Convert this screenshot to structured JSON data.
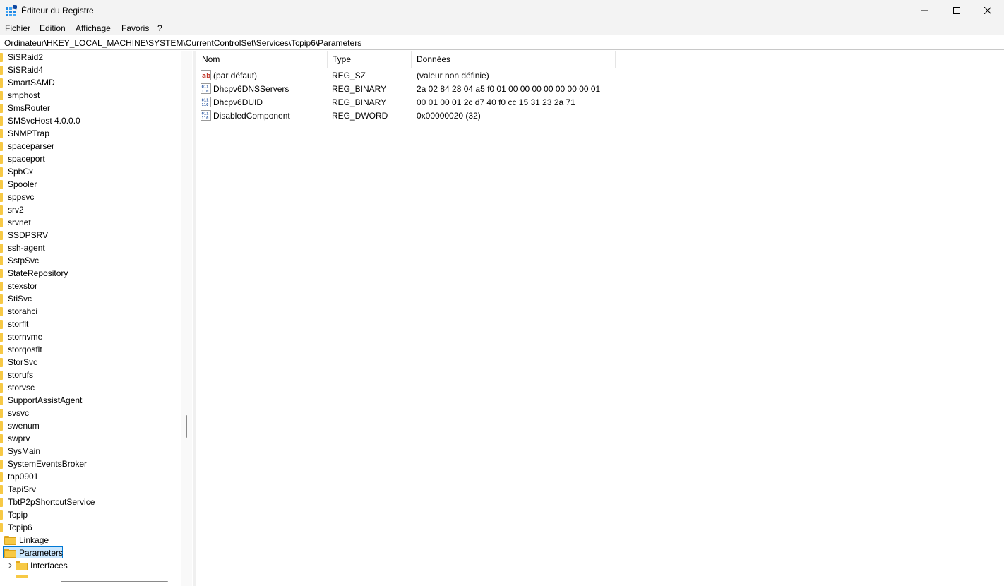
{
  "window": {
    "title": "Éditeur du Registre"
  },
  "menu": [
    "Fichier",
    "Edition",
    "Affichage",
    "Favoris",
    "?"
  ],
  "address": "Ordinateur\\HKEY_LOCAL_MACHINE\\SYSTEM\\CurrentControlSet\\Services\\Tcpip6\\Parameters",
  "tree": {
    "keys": [
      "SiSRaid2",
      "SiSRaid4",
      "SmartSAMD",
      "smphost",
      "SmsRouter",
      "SMSvcHost 4.0.0.0",
      "SNMPTrap",
      "spaceparser",
      "spaceport",
      "SpbCx",
      "Spooler",
      "sppsvc",
      "srv2",
      "srvnet",
      "SSDPSRV",
      "ssh-agent",
      "SstpSvc",
      "StateRepository",
      "stexstor",
      "StiSvc",
      "storahci",
      "storflt",
      "stornvme",
      "storqosflt",
      "StorSvc",
      "storufs",
      "storvsc",
      "SupportAssistAgent",
      "svsvc",
      "swenum",
      "swprv",
      "SysMain",
      "SystemEventsBroker",
      "tap0901",
      "TapiSrv",
      "TbtP2pShortcutService",
      "Tcpip",
      "Tcpip6"
    ],
    "children": [
      {
        "label": "Linkage",
        "selected": false,
        "expandable": false
      },
      {
        "label": "Parameters",
        "selected": true,
        "expandable": false
      },
      {
        "label": "Interfaces",
        "selected": false,
        "expandable": true
      }
    ]
  },
  "list": {
    "columns": {
      "name": "Nom",
      "type": "Type",
      "data": "Données"
    },
    "rows": [
      {
        "icon": "string-value-icon",
        "name": "(par défaut)",
        "type": "REG_SZ",
        "data": "(valeur non définie)"
      },
      {
        "icon": "binary-value-icon",
        "name": "Dhcpv6DNSServers",
        "type": "REG_BINARY",
        "data": "2a 02 84 28 04 a5 f0 01 00 00 00 00 00 00 00 01"
      },
      {
        "icon": "binary-value-icon",
        "name": "Dhcpv6DUID",
        "type": "REG_BINARY",
        "data": "00 01 00 01 2c d7 40 f0 cc 15 31 23 2a 71"
      },
      {
        "icon": "binary-value-icon",
        "name": "DisabledComponent",
        "type": "REG_DWORD",
        "data": "0x00000020 (32)"
      }
    ]
  },
  "colors": {
    "folder": "#f7c945",
    "selection": "#cce8ff",
    "selection_border": "#0078d4",
    "chrome": "#f3f3f3"
  }
}
